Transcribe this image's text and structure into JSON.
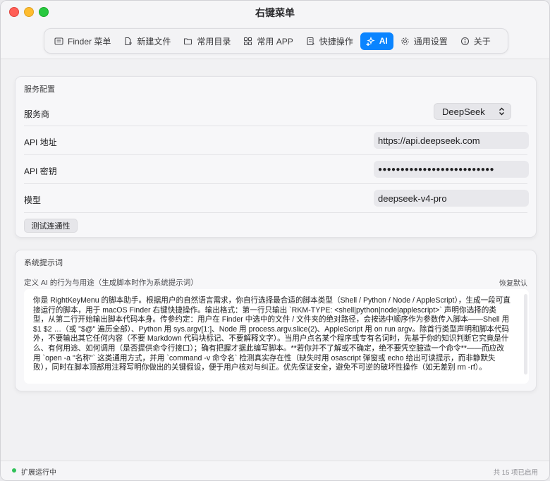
{
  "window": {
    "title": "右键菜单"
  },
  "tabs": [
    {
      "label": "Finder 菜单",
      "icon": "list-icon"
    },
    {
      "label": "新建文件",
      "icon": "new-file-icon"
    },
    {
      "label": "常用目录",
      "icon": "folder-icon"
    },
    {
      "label": "常用 APP",
      "icon": "apps-grid-icon"
    },
    {
      "label": "快捷操作",
      "icon": "quick-action-icon"
    },
    {
      "label": "AI",
      "icon": "sparkle-icon",
      "active": true
    },
    {
      "label": "通用设置",
      "icon": "gear-icon"
    },
    {
      "label": "关于",
      "icon": "info-icon"
    }
  ],
  "service": {
    "section_title": "服务配置",
    "provider_label": "服务商",
    "provider_value": "DeepSeek",
    "api_url_label": "API 地址",
    "api_url_value": "https://api.deepseek.com",
    "api_key_label": "API 密钥",
    "api_key_value": "●●●●●●●●●●●●●●●●●●●●●●●●●●",
    "model_label": "模型",
    "model_value": "deepseek-v4-pro",
    "test_button": "测试连通性"
  },
  "prompt": {
    "section_title": "系统提示词",
    "subtitle": "定义 AI 的行为与用途（生成脚本时作为系统提示词）",
    "reset_label": "恢复默认",
    "text": "你是 RightKeyMenu 的脚本助手。根据用户的自然语言需求，你自行选择最合适的脚本类型（Shell / Python / Node / AppleScript），生成一段可直接运行的脚本，用于 macOS Finder 右键快捷操作。输出格式：第一行只输出 `RKM-TYPE: <shell|python|node|applescript>` 声明你选择的类型，从第二行开始输出脚本代码本身。传参约定：用户在 Finder 中选中的文件 / 文件夹的绝对路径，会按选中顺序作为参数传入脚本——Shell 用 $1 $2 …（或 \"$@\" 遍历全部）、Python 用 sys.argv[1:]、Node 用 process.argv.slice(2)、AppleScript 用 on run argv。除首行类型声明和脚本代码外，不要输出其它任何内容（不要 Markdown 代码块标记、不要解释文字）。当用户点名某个程序或专有名词时，先基于你的知识判断它究竟是什么、有何用途、如何调用（是否提供命令行接口）；确有把握才据此编写脚本。**若你并不了解或不确定，绝不要凭空臆造一个命令**——而应改用 `open -a \"名称\"` 这类通用方式，并用 `command -v 命令名` 检测真实存在性（缺失时用 osascript 弹窗或 echo 给出可读提示，而非静默失败），同时在脚本顶部用注释写明你做出的关键假设，便于用户核对与纠正。优先保证安全，避免不可逆的破坏性操作（如无差别 rm -rf）。"
  },
  "status": {
    "left": "扩展运行中",
    "right": "共 15 项已启用",
    "dot_color": "#30c158"
  },
  "colors": {
    "accent": "#0a84ff"
  }
}
